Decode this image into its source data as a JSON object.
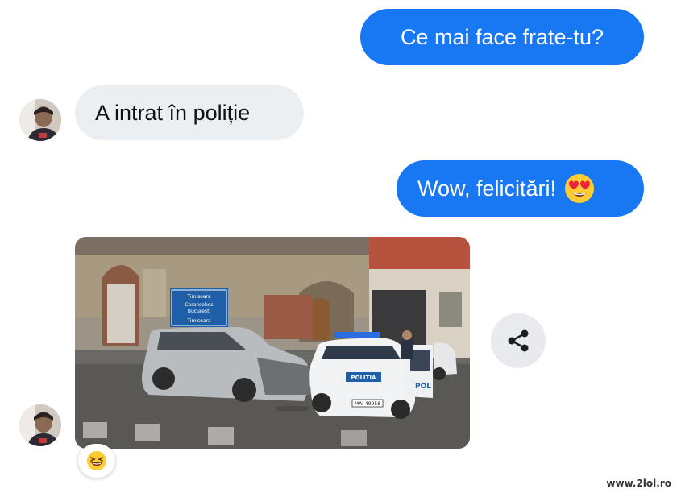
{
  "messages": [
    {
      "direction": "outgoing",
      "text": "Ce mai face frate-tu?"
    },
    {
      "direction": "incoming",
      "text": "A intrat în poliție"
    },
    {
      "direction": "outgoing",
      "text": "Wow, felicitări!",
      "emoji": "heart-eyes-emoji"
    },
    {
      "direction": "incoming",
      "attachment": "photo",
      "photo": {
        "signs": [
          "Timisoara",
          "Caransebes",
          "Bucuresti",
          "Timisoara"
        ],
        "police_door_text": "POL",
        "police_hood_text": "POLITIA",
        "license_plate": "MAI 49958"
      }
    }
  ],
  "reaction": {
    "emoji": "laughing-face-emoji"
  },
  "share": {
    "icon": "share-icon"
  },
  "watermark": "www.2lol.ro",
  "colors": {
    "outgoing_bubble": "#1877f2",
    "incoming_bubble": "#eceff2",
    "background": "#ffffff"
  }
}
